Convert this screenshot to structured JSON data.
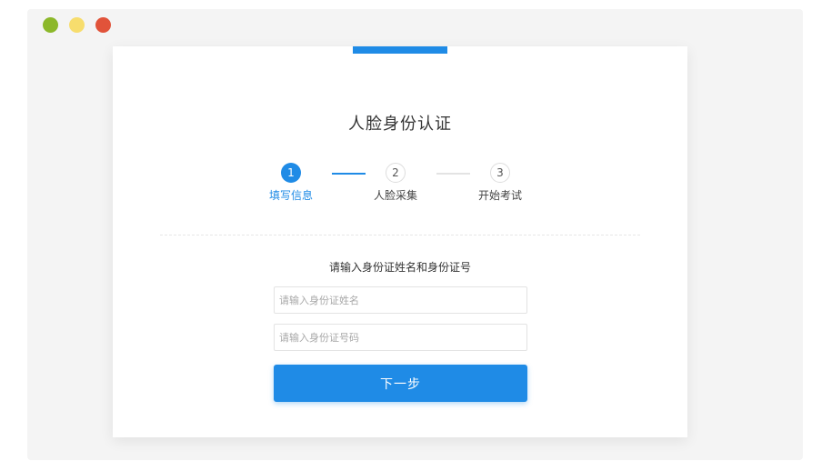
{
  "window": {
    "traffic_lights": {
      "green": "#8cb82a",
      "yellow": "#f7dd6d",
      "red": "#e1533a"
    }
  },
  "page": {
    "title": "人脸身份认证",
    "accent_color": "#1f8be6"
  },
  "steps": [
    {
      "number": "1",
      "label": "填写信息",
      "state": "active"
    },
    {
      "number": "2",
      "label": "人脸采集",
      "state": "pending"
    },
    {
      "number": "3",
      "label": "开始考试",
      "state": "pending"
    }
  ],
  "form": {
    "instruction": "请输入身份证姓名和身份证号",
    "name_placeholder": "请输入身份证姓名",
    "id_placeholder": "请输入身份证号码",
    "next_label": "下一步"
  }
}
